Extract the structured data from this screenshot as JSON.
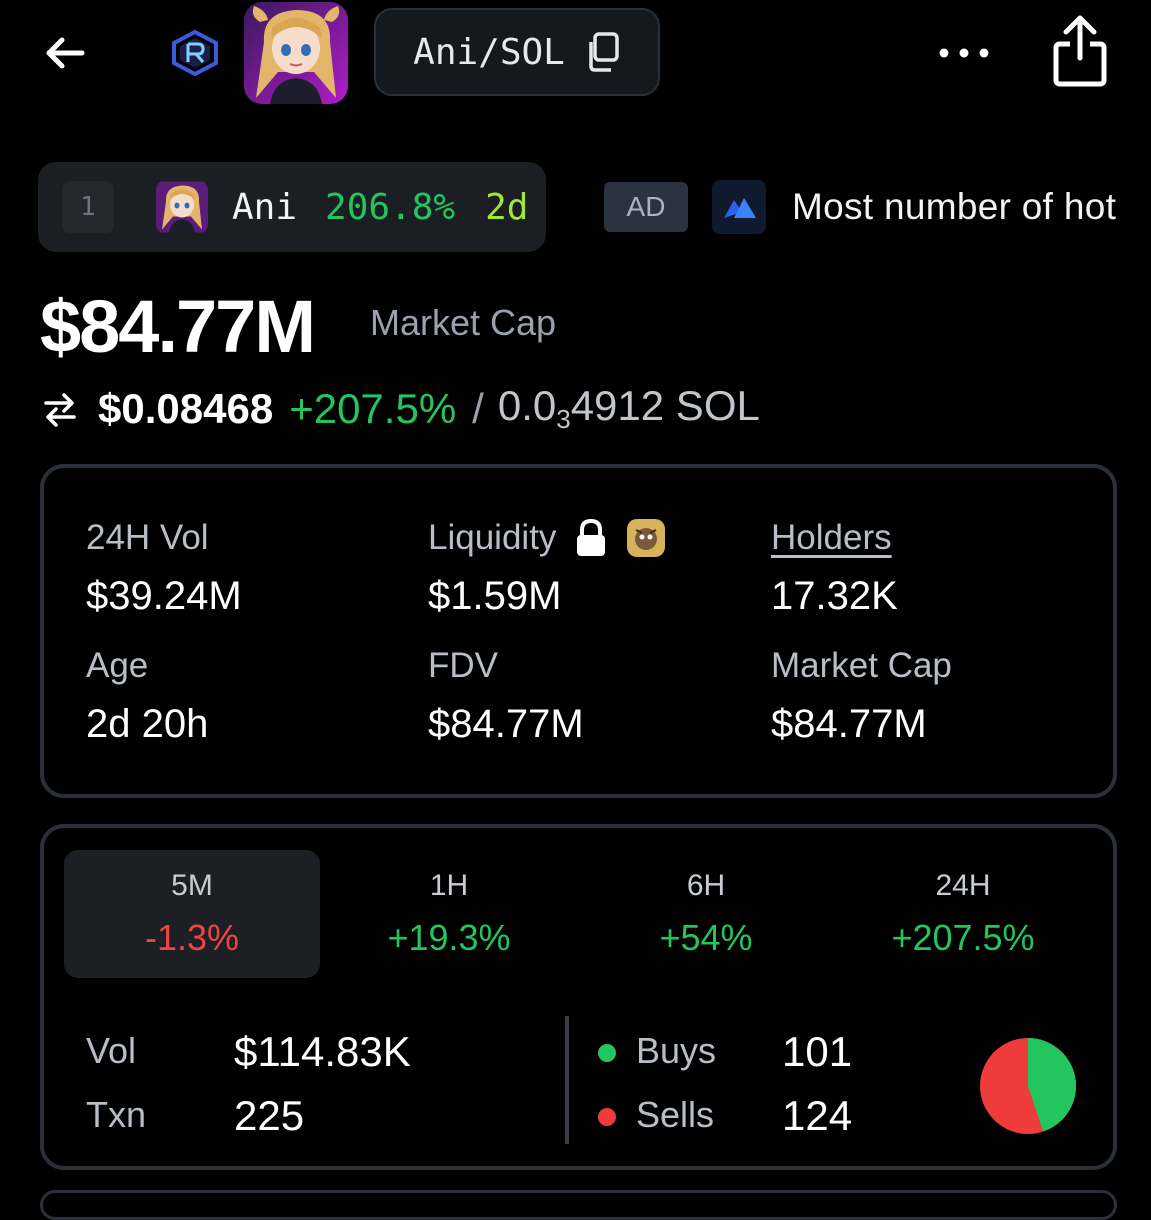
{
  "header": {
    "pair_label": "Ani/SOL",
    "icons": [
      "back-arrow-icon",
      "raydium-logo-icon",
      "token-avatar",
      "copy-icon",
      "more-dots-icon",
      "share-icon"
    ]
  },
  "ticker": {
    "rank": "1",
    "name": "Ani",
    "change": "206.8%",
    "age": "2d"
  },
  "ad": {
    "badge": "AD",
    "text": "Most number of hot"
  },
  "summary": {
    "market_cap_value": "$84.77M",
    "market_cap_label": "Market Cap",
    "price": "$0.08468",
    "price_change": "+207.5%",
    "slash": "/",
    "sol_price_prefix": "0.0",
    "sol_price_zeros": "3",
    "sol_price_rest": "4912 SOL"
  },
  "stats": {
    "vol_label": "24H Vol",
    "vol_value": "$39.24M",
    "liq_label": "Liquidity",
    "liq_value": "$1.59M",
    "holders_label": "Holders",
    "holders_value": "17.32K",
    "age_label": "Age",
    "age_value": "2d 20h",
    "fdv_label": "FDV",
    "fdv_value": "$84.77M",
    "mcap_label": "Market Cap",
    "mcap_value": "$84.77M"
  },
  "timeframes": [
    {
      "label": "5M",
      "value": "-1.3%",
      "active": true
    },
    {
      "label": "1H",
      "value": "+19.3%",
      "active": false
    },
    {
      "label": "6H",
      "value": "+54%",
      "active": false
    },
    {
      "label": "24H",
      "value": "+207.5%",
      "active": false
    }
  ],
  "activity": {
    "vol_label": "Vol",
    "vol_value": "$114.83K",
    "txn_label": "Txn",
    "txn_value": "225",
    "buys_label": "Buys",
    "buys_value": "101",
    "sells_label": "Sells",
    "sells_value": "124"
  },
  "colors": {
    "positive": "#22c55e",
    "negative": "#ef4444",
    "buys": "#22c55e",
    "sells": "#ef3b3b"
  }
}
